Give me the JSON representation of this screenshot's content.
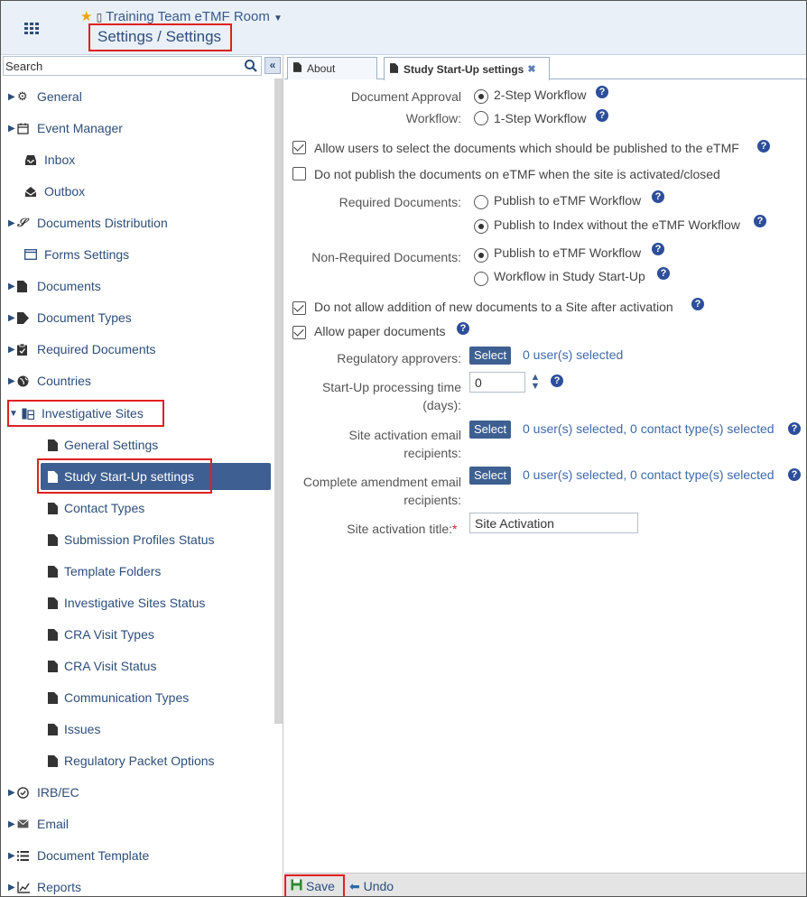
{
  "header": {
    "room_name": "Training Team eTMF Room",
    "page_title": "Settings / Settings"
  },
  "sidebar": {
    "search_placeholder": "Search",
    "items": [
      {
        "label": "General",
        "icon": "gears-icon"
      },
      {
        "label": "Event Manager",
        "icon": "calendar-icon"
      },
      {
        "label": "Inbox",
        "icon": "inbox-icon"
      },
      {
        "label": "Outbox",
        "icon": "outbox-icon"
      },
      {
        "label": "Documents Distribution",
        "icon": "share-icon"
      },
      {
        "label": "Forms Settings",
        "icon": "form-icon"
      },
      {
        "label": "Documents",
        "icon": "document-icon"
      },
      {
        "label": "Document Types",
        "icon": "tag-icon"
      },
      {
        "label": "Required Documents",
        "icon": "clipboard-icon"
      },
      {
        "label": "Countries",
        "icon": "globe-icon"
      },
      {
        "label": "Investigative Sites",
        "icon": "sites-icon"
      },
      {
        "label": "IRB/EC",
        "icon": "check-circle-icon"
      },
      {
        "label": "Email",
        "icon": "envelope-icon"
      },
      {
        "label": "Document Template",
        "icon": "list-icon"
      },
      {
        "label": "Reports",
        "icon": "chart-icon"
      }
    ],
    "sub_items": [
      "General Settings",
      "Study Start-Up settings",
      "Contact Types",
      "Submission Profiles Status",
      "Template Folders",
      "Investigative Sites Status",
      "CRA Visit Types",
      "CRA Visit Status",
      "Communication Types",
      "Issues",
      "Regulatory Packet Options"
    ]
  },
  "tabs": {
    "about": "About",
    "startup": "Study Start-Up settings"
  },
  "form": {
    "approval_label_1": "Document Approval",
    "approval_label_2": "Workflow:",
    "approval_opt1": "2-Step Workflow",
    "approval_opt2": "1-Step Workflow",
    "allow_select_docs": "Allow users to select the documents which should be published to the eTMF",
    "do_not_publish": "Do not publish the documents on eTMF when the site is activated/closed",
    "required_docs_label": "Required Documents:",
    "required_opt1": "Publish to eTMF Workflow",
    "required_opt2": "Publish to Index without the eTMF Workflow",
    "nonrequired_docs_label": "Non-Required Documents:",
    "nonrequired_opt1": "Publish to eTMF Workflow",
    "nonrequired_opt2": "Workflow in Study Start-Up",
    "no_addition": "Do not allow addition of new documents to a Site after activation",
    "allow_paper": "Allow paper documents",
    "reg_approvers_label": "Regulatory approvers:",
    "select_label": "Select",
    "reg_approvers_info": "0 user(s) selected",
    "processing_label_1": "Start-Up processing time",
    "processing_label_2": "(days):",
    "processing_value": "0",
    "activation_email_label_1": "Site activation email",
    "activation_email_label_2": "recipients:",
    "activation_email_info": "0 user(s) selected, 0 contact type(s) selected",
    "amendment_email_label_1": "Complete amendment email",
    "amendment_email_label_2": "recipients:",
    "amendment_email_info": "0 user(s) selected, 0 contact type(s) selected",
    "activation_title_label": "Site activation title:",
    "activation_title_value": "Site Activation"
  },
  "footer": {
    "save": "Save",
    "undo": "Undo"
  },
  "colors": {
    "accent": "#3e5f91",
    "highlight_outline": "#e02020",
    "star": "#f0a30a"
  }
}
